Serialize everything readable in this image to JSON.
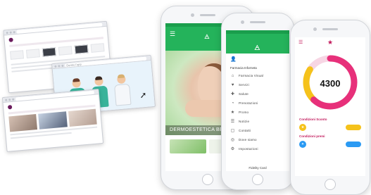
{
  "browser_windows": {
    "win_a": {
      "url": ""
    },
    "win_b": {
      "url": "Dentro l'app"
    },
    "win_c": {
      "url": ""
    }
  },
  "phone_1": {
    "header_logo": "🜁",
    "tabs": [
      "",
      "",
      ""
    ],
    "hero_caption": "DERMOESTETICA BELLEZZA",
    "accent": "#24b35b"
  },
  "phone_2": {
    "header_logo": "🜁",
    "section_title": "Farmacia Inforneta",
    "menu_items": [
      {
        "icon": "⌂",
        "label": "Farmacia Visual"
      },
      {
        "icon": "♥",
        "label": "Servizi"
      },
      {
        "icon": "✚",
        "label": "Salute"
      },
      {
        "icon": "◔",
        "label": "Prenotazioni"
      },
      {
        "icon": "★",
        "label": "Promo"
      },
      {
        "icon": "☰",
        "label": "Notizie"
      },
      {
        "icon": "▢",
        "label": "Contatti"
      },
      {
        "icon": "◎",
        "label": "Dove siamo"
      },
      {
        "icon": "⚙",
        "label": "Impostazioni"
      }
    ],
    "footer": "Fidelity Card"
  },
  "phone_3": {
    "points_value": "4300",
    "ring_progress": 0.62,
    "ring_colors": {
      "primary": "#e7307a",
      "secondary": "#f5c21b"
    },
    "section_1_title": "Condizioni Sconto",
    "section_1_text": "",
    "row_1": {
      "label": "",
      "button": ""
    },
    "section_2_title": "Condizioni premi",
    "section_2_text": "",
    "row_2": {
      "label": "",
      "button": ""
    },
    "bottom_link": ""
  }
}
